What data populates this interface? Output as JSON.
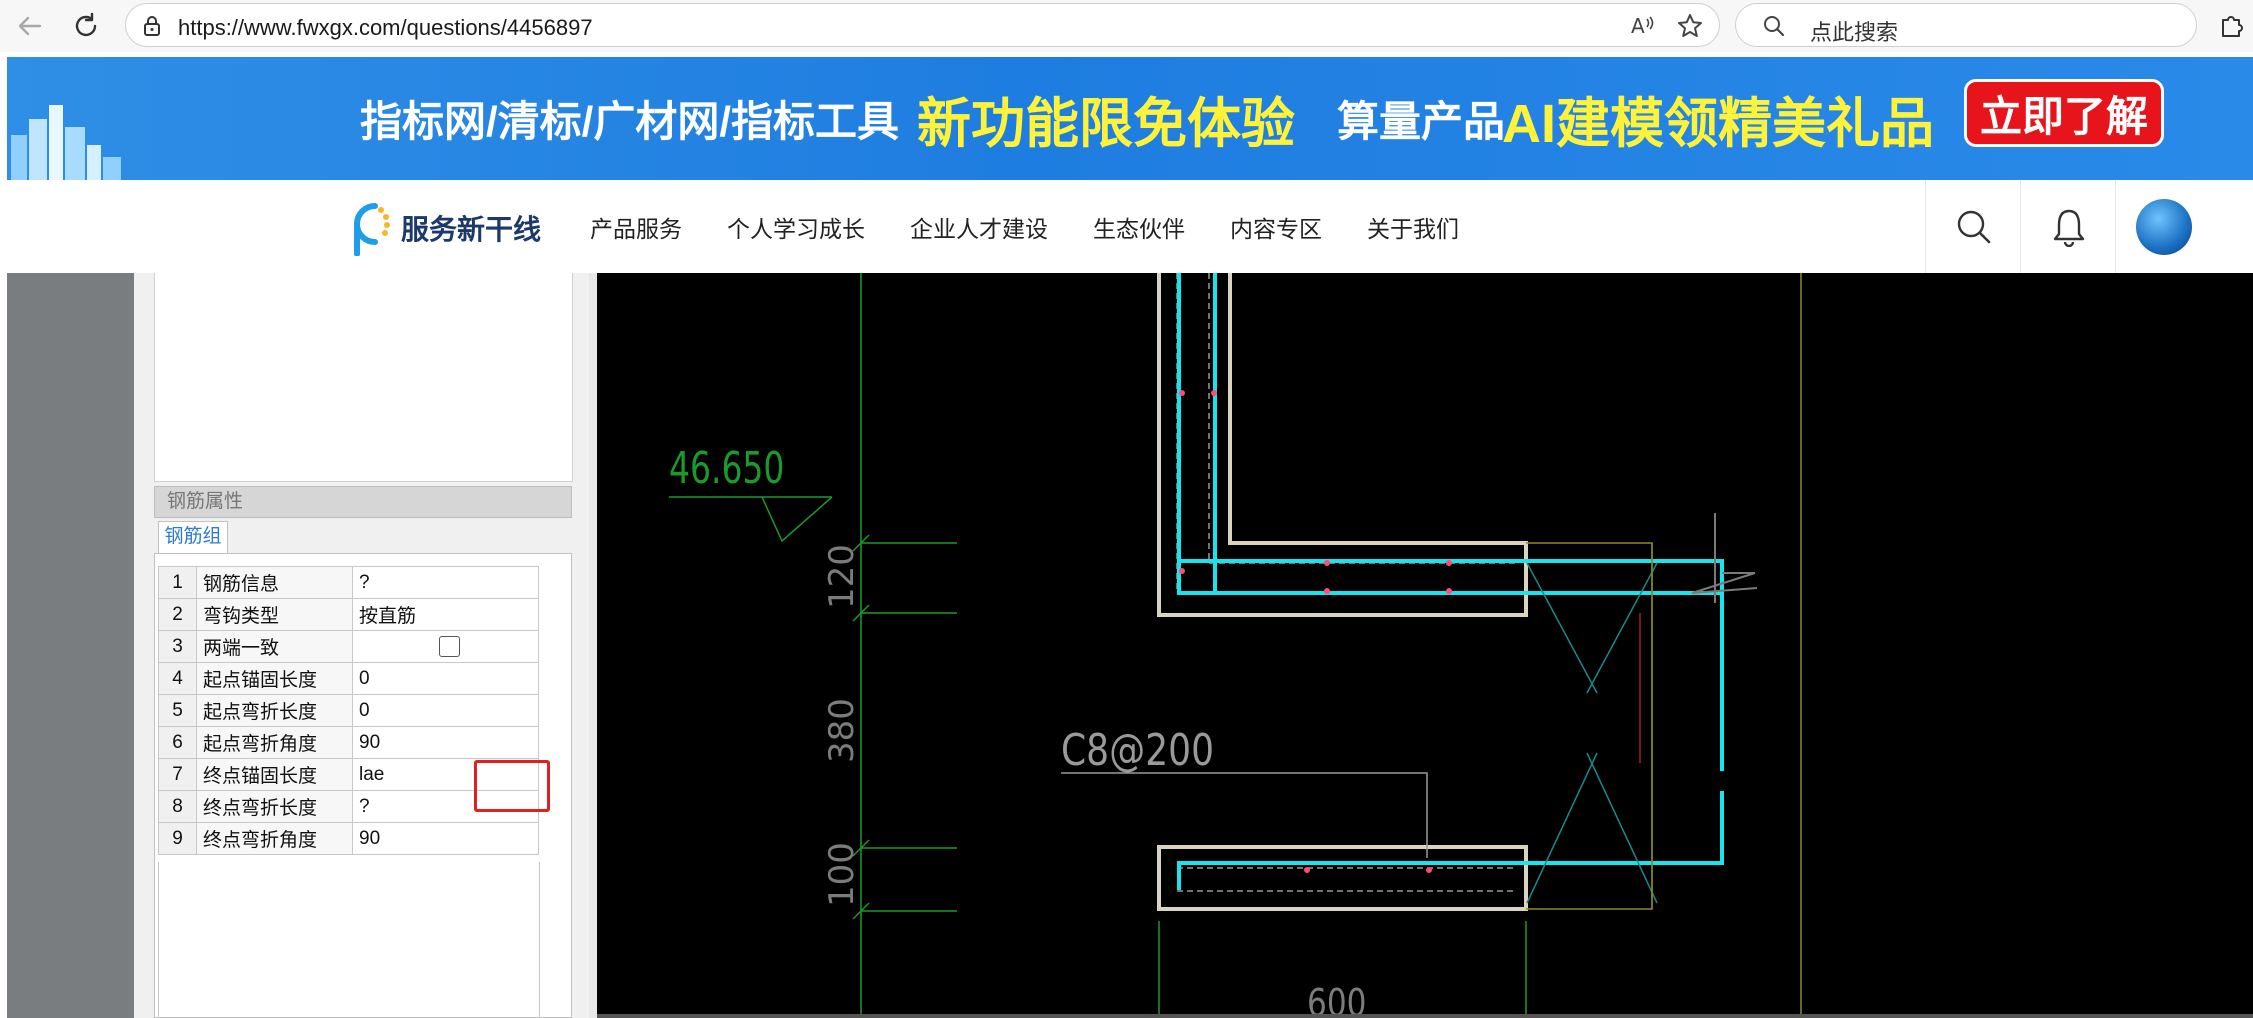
{
  "browser": {
    "url": "https://www.fwxgx.com/questions/4456897",
    "search_placeholder": "点此搜索",
    "icons": [
      "back-icon",
      "refresh-icon",
      "lock-icon",
      "read-aloud-icon",
      "favorite-star-icon",
      "search-icon",
      "extensions-icon"
    ]
  },
  "banner": {
    "part1": "指标网/清标/广材网/指标工具",
    "part2": "新功能限免体验",
    "part3": "算量产品",
    "part4": "AI建模领精美礼品",
    "button": "立即了解",
    "colors": {
      "background": "#1e7de0",
      "highlight": "#fff23a",
      "button": "#e8141b"
    }
  },
  "site_nav": {
    "logo_text": "服务新干线",
    "items": [
      "产品服务",
      "个人学习成长",
      "企业人才建设",
      "生态伙伴",
      "内容专区",
      "关于我们"
    ],
    "icons": [
      "search-icon",
      "bell-icon",
      "user-avatar"
    ]
  },
  "property_panel": {
    "section_title": "钢筋属性",
    "tab_label": "钢筋组",
    "rows": [
      {
        "index": "1",
        "name": "钢筋信息",
        "value": "?"
      },
      {
        "index": "2",
        "name": "弯钩类型",
        "value": "按直筋"
      },
      {
        "index": "3",
        "name": "两端一致",
        "value": ""
      },
      {
        "index": "4",
        "name": "起点锚固长度",
        "value": "0"
      },
      {
        "index": "5",
        "name": "起点弯折长度",
        "value": "0"
      },
      {
        "index": "6",
        "name": "起点弯折角度",
        "value": "90"
      },
      {
        "index": "7",
        "name": "终点锚固长度",
        "value": "lae"
      },
      {
        "index": "8",
        "name": "终点弯折长度",
        "value": "?"
      },
      {
        "index": "9",
        "name": "终点弯折角度",
        "value": "90"
      }
    ],
    "checkbox_row_index": 2,
    "highlight_row_index": 6,
    "highlight_color": "#e02020"
  },
  "cad": {
    "elevation_label": "46.650",
    "dims": [
      "120",
      "380",
      "100"
    ],
    "bottom_dim": "600",
    "rebar_label": "C8@200",
    "colors": {
      "rebar": "#18e4ee",
      "concrete": "#d8d4bf",
      "dim": "#1a9a2a",
      "text": "#8a8a8a"
    }
  }
}
